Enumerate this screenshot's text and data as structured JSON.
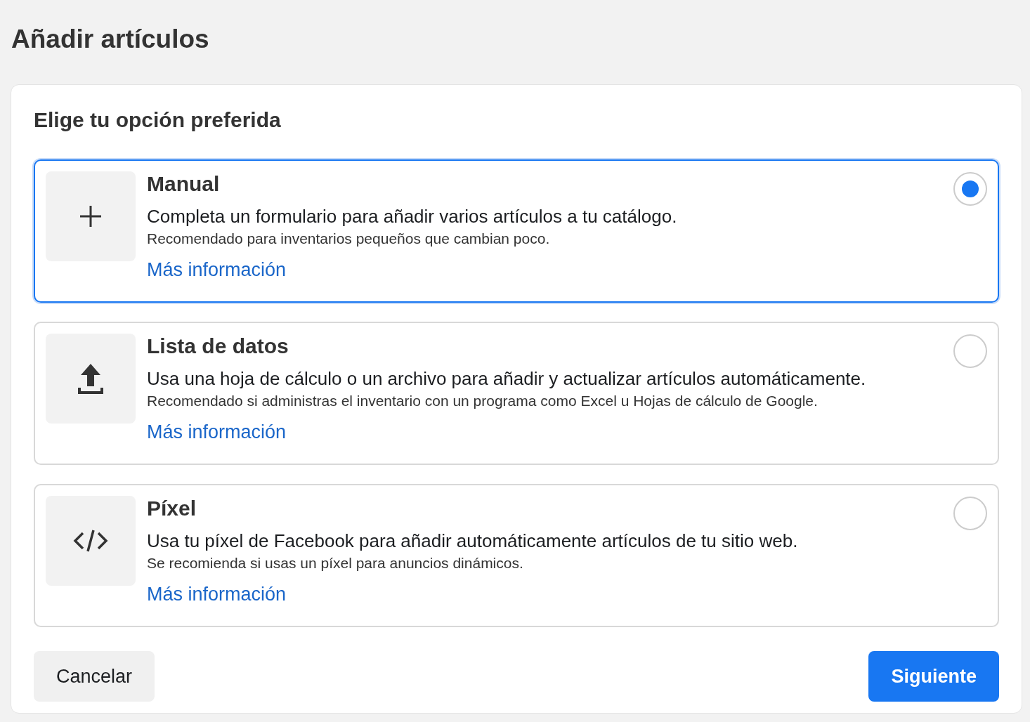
{
  "page_title": "Añadir artículos",
  "card": {
    "heading": "Elige tu opción preferida",
    "options": [
      {
        "kind": "plus",
        "title": "Manual",
        "description": "Completa un formulario para añadir varios artículos a tu catálogo.",
        "note": "Recomendado para inventarios pequeños que cambian poco.",
        "link": "Más información",
        "selected": true
      },
      {
        "kind": "upload",
        "title": "Lista de datos",
        "description": "Usa una hoja de cálculo o un archivo para añadir y actualizar artículos automáticamente.",
        "note": "Recomendado si administras el inventario con un programa como Excel u Hojas de cálculo de Google.",
        "link": "Más información",
        "selected": false
      },
      {
        "kind": "code",
        "title": "Píxel",
        "description": "Usa tu píxel de Facebook para añadir automáticamente artículos de tu sitio web.",
        "note": "Se recomienda si usas un píxel para anuncios dinámicos.",
        "link": "Más información",
        "selected": false
      }
    ],
    "buttons": {
      "cancel": "Cancelar",
      "next": "Siguiente"
    }
  }
}
